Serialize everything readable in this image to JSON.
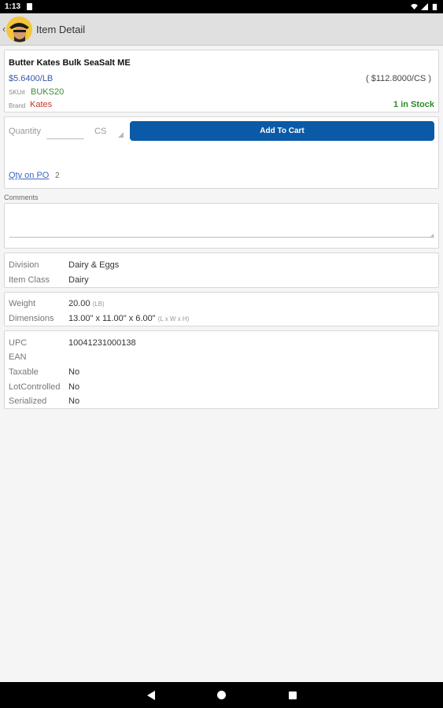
{
  "status_bar": {
    "time": "1:13"
  },
  "header": {
    "title": "Item Detail"
  },
  "item": {
    "name": "Butter Kates Bulk SeaSalt ME",
    "price": "$5.6400/LB",
    "case_price": "( $112.8000/CS )",
    "sku_label": "SKU#",
    "sku": "BUKS20",
    "brand_label": "Brand",
    "brand": "Kates",
    "stock": "1 in Stock"
  },
  "order": {
    "quantity_label": "Quantity",
    "quantity_value": "",
    "uom": "CS",
    "add_button": "Add To Cart",
    "qty_on_po_label": "Qty on PO",
    "qty_on_po_value": "2"
  },
  "comments": {
    "label": "Comments",
    "value": ""
  },
  "classification": [
    {
      "key": "Division",
      "value": "Dairy & Eggs"
    },
    {
      "key": "Item Class",
      "value": "Dairy"
    }
  ],
  "physical": {
    "weight_label": "Weight",
    "weight_value": "20.00",
    "weight_unit": "(LB)",
    "dimensions_label": "Dimensions",
    "dimensions_value": "13.00\" x 11.00\" x 6.00\"",
    "dimensions_unit": "(L x W x H)"
  },
  "attributes": [
    {
      "key": "UPC",
      "value": "10041231000138"
    },
    {
      "key": "EAN",
      "value": ""
    },
    {
      "key": "Taxable",
      "value": "No"
    },
    {
      "key": "LotControlled",
      "value": "No"
    },
    {
      "key": "Serialized",
      "value": "No"
    }
  ]
}
